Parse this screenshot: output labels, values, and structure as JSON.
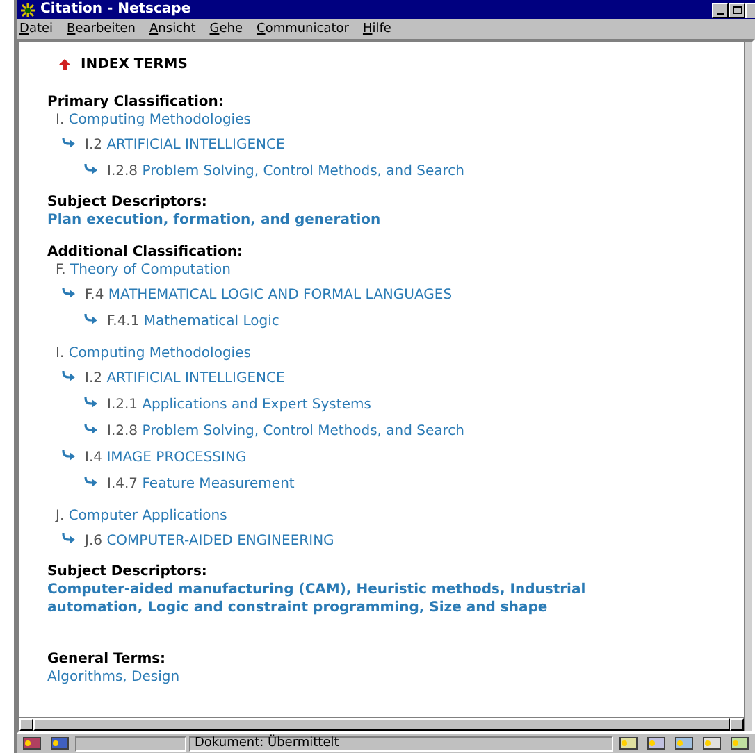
{
  "window": {
    "title": "Citation - Netscape"
  },
  "menu": [
    "Datei",
    "Bearbeiten",
    "Ansicht",
    "Gehe",
    "Communicator",
    "Hilfe"
  ],
  "page_title": "INDEX TERMS",
  "sections": [
    {
      "kind": "classification",
      "heading": "Primary Classification:",
      "groups": [
        {
          "code": "I.",
          "label": "Computing Methodologies",
          "children": [
            {
              "code": "I.2",
              "label": "ARTIFICIAL INTELLIGENCE",
              "children": [
                {
                  "code": "I.2.8",
                  "label": "Problem Solving, Control Methods, and Search"
                }
              ]
            }
          ]
        }
      ]
    },
    {
      "kind": "descriptors",
      "heading": "Subject Descriptors:",
      "text": "Plan execution, formation, and generation"
    },
    {
      "kind": "classification",
      "heading": "Additional Classification:",
      "groups": [
        {
          "code": "F.",
          "label": "Theory of Computation",
          "children": [
            {
              "code": "F.4",
              "label": "MATHEMATICAL LOGIC AND FORMAL LANGUAGES",
              "children": [
                {
                  "code": "F.4.1",
                  "label": "Mathematical Logic"
                }
              ]
            }
          ]
        },
        {
          "code": "I.",
          "label": "Computing Methodologies",
          "children": [
            {
              "code": "I.2",
              "label": "ARTIFICIAL INTELLIGENCE",
              "children": [
                {
                  "code": "I.2.1",
                  "label": "Applications and Expert Systems"
                },
                {
                  "code": "I.2.8",
                  "label": "Problem Solving, Control Methods, and Search"
                }
              ]
            },
            {
              "code": "I.4",
              "label": "IMAGE PROCESSING",
              "children": [
                {
                  "code": "I.4.7",
                  "label": "Feature Measurement"
                }
              ]
            }
          ]
        },
        {
          "code": "J.",
          "label": "Computer Applications",
          "children": [
            {
              "code": "J.6",
              "label": "COMPUTER-AIDED ENGINEERING"
            }
          ]
        }
      ]
    },
    {
      "kind": "descriptors",
      "heading": "Subject Descriptors:",
      "text": "Computer-aided manufacturing (CAM), Heuristic methods, Industrial automation, Logic and constraint programming, Size and shape"
    },
    {
      "kind": "terms",
      "heading": "General Terms:",
      "text": "Algorithms, Design"
    }
  ],
  "status_bar": {
    "text": "Dokument: Übermittelt"
  }
}
